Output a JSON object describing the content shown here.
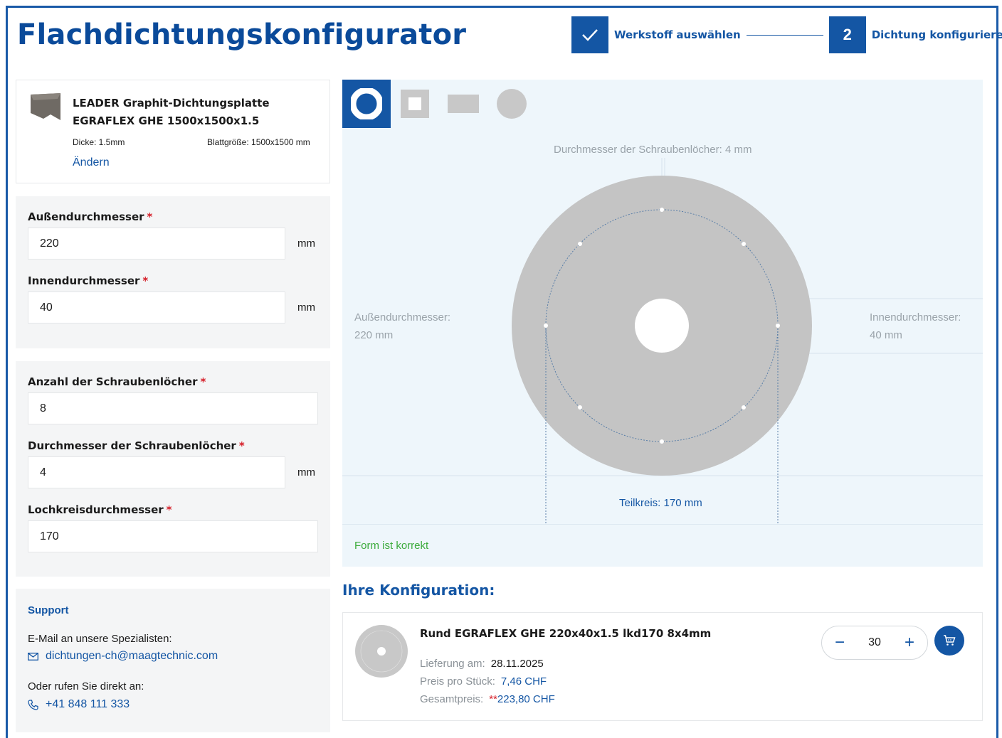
{
  "header": {
    "title": "Flachdichtungskonfigurator",
    "steps": [
      {
        "badge": "",
        "label": "Werkstoff auswählen",
        "state": "done"
      },
      {
        "badge": "2",
        "label": "Dichtung konfigurieren",
        "state": "active"
      }
    ]
  },
  "product": {
    "name": "LEADER Graphit-Dichtungsplatte EGRAFLEX GHE 1500x1500x1.5",
    "thickness": "Dicke: 1.5mm",
    "sheet_size": "Blattgröße: 1500x1500 mm",
    "change_label": "Ändern"
  },
  "dimensions": {
    "outer_label": "Außendurchmesser",
    "outer_value": "220",
    "inner_label": "Innendurchmesser",
    "inner_value": "40",
    "unit": "mm"
  },
  "bolt_holes": {
    "count_label": "Anzahl der Schraubenlöcher",
    "count_value": "8",
    "diameter_label": "Durchmesser der Schraubenlöcher",
    "diameter_value": "4",
    "circle_label": "Lochkreisdurchmesser",
    "circle_value": "170",
    "unit": "mm"
  },
  "required_mark": "*",
  "support": {
    "title": "Support",
    "email_prompt": "E-Mail an unsere Spezialisten:",
    "email": "dichtungen-ch@maagtechnic.com",
    "phone_prompt": "Oder rufen Sie direkt an:",
    "phone": "+41 848 111 333"
  },
  "preview": {
    "shapes": [
      "ring-icon",
      "square-icon",
      "rectangle-icon",
      "disc-icon"
    ],
    "active_shape": "ring-icon",
    "bolt_hole_label": "Durchmesser der Schraubenlöcher: 4 mm",
    "outer_label_line1": "Außendurchmesser:",
    "outer_label_line2": "220 mm",
    "inner_label_line1": "Innendurchmesser:",
    "inner_label_line2": "40 mm",
    "pitch_label": "Teilkreis: 170 mm",
    "status": "Form ist korrekt"
  },
  "configuration": {
    "title": "Ihre Konfiguration:",
    "item_name": "Rund EGRAFLEX GHE 220x40x1.5 lkd170 8x4mm",
    "delivery_label": "Lieferung am:",
    "delivery_value": "28.11.2025",
    "unit_price_label": "Preis pro Stück:",
    "unit_price_value": "7,46 CHF",
    "total_label": "Gesamtpreis:",
    "total_stars": "**",
    "total_value": "223,80 CHF",
    "quantity": "30",
    "minus": "−",
    "plus": "+"
  },
  "colors": {
    "brand": "#1456a4",
    "success": "#3cab3c",
    "required": "#d6202a",
    "gasket": "#c4c4c4"
  }
}
